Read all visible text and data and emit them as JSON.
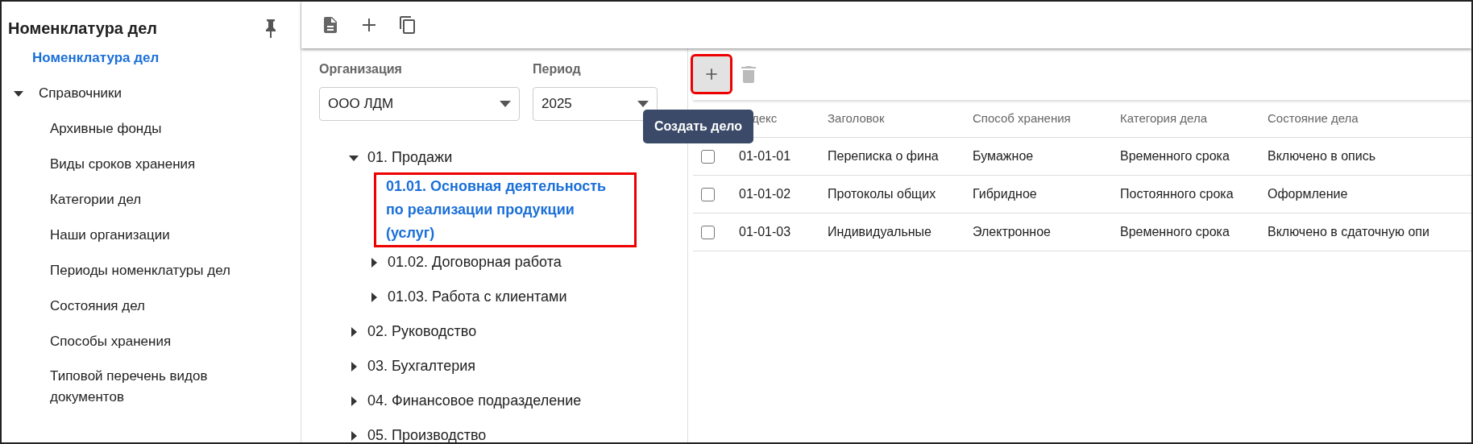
{
  "sidebar": {
    "title": "Номенклатура дел",
    "items": [
      {
        "label": "Номенклатура дел",
        "selected": true
      },
      {
        "label": "Справочники",
        "selected": false,
        "expanded": true,
        "children": [
          {
            "label": "Архивные фонды",
            "selected": false
          },
          {
            "label": "Виды сроков хранения",
            "selected": false
          },
          {
            "label": "Категории дел",
            "selected": false
          },
          {
            "label": "Наши организации",
            "selected": false
          },
          {
            "label": "Периоды номенклатуры дел",
            "selected": false
          },
          {
            "label": "Состояния дел",
            "selected": false
          },
          {
            "label": "Способы хранения",
            "selected": false
          },
          {
            "label": "Типовой перечень видов документов",
            "selected": false
          }
        ]
      }
    ]
  },
  "filters": [
    {
      "label": "Организация",
      "value": "ООО ЛДМ"
    },
    {
      "label": "Период",
      "value": "2025"
    }
  ],
  "tree": [
    {
      "label": "01. Продажи",
      "expanded": true,
      "selected": false,
      "children": [
        {
          "label": "01.01. Основная деятельность по реализации продукции (услуг)",
          "selected": true,
          "highlighted": true
        },
        {
          "label": "01.02. Договорная работа",
          "expanded": false,
          "selected": false
        },
        {
          "label": "01.03. Работа с клиентами",
          "expanded": false,
          "selected": false
        }
      ]
    },
    {
      "label": "02. Руководство",
      "expanded": false,
      "selected": false
    },
    {
      "label": "03. Бухгалтерия",
      "expanded": false,
      "selected": false
    },
    {
      "label": "04. Финансовое подразделение",
      "expanded": false,
      "selected": false
    },
    {
      "label": "05. Производство",
      "expanded": false,
      "selected": false
    }
  ],
  "grid": {
    "add_button": {
      "highlighted": true
    },
    "delete_button": {
      "disabled": true
    },
    "tooltip": "Создать дело",
    "columns": [
      "декс",
      "Заголовок",
      "Способ хранения",
      "Категория дела",
      "Состояние дела"
    ],
    "rows": [
      {
        "checked": false,
        "cells": [
          "01-01-01",
          "Переписка о фина",
          "Бумажное",
          "Временного срока",
          "Включено в опись"
        ]
      },
      {
        "checked": false,
        "cells": [
          "01-01-02",
          "Протоколы общих",
          "Гибридное",
          "Постоянного срока",
          "Оформление"
        ]
      },
      {
        "checked": false,
        "cells": [
          "01-01-03",
          "Индивидуальные",
          "Электронное",
          "Временного срока",
          "Включено в сдаточную опи"
        ]
      }
    ]
  }
}
